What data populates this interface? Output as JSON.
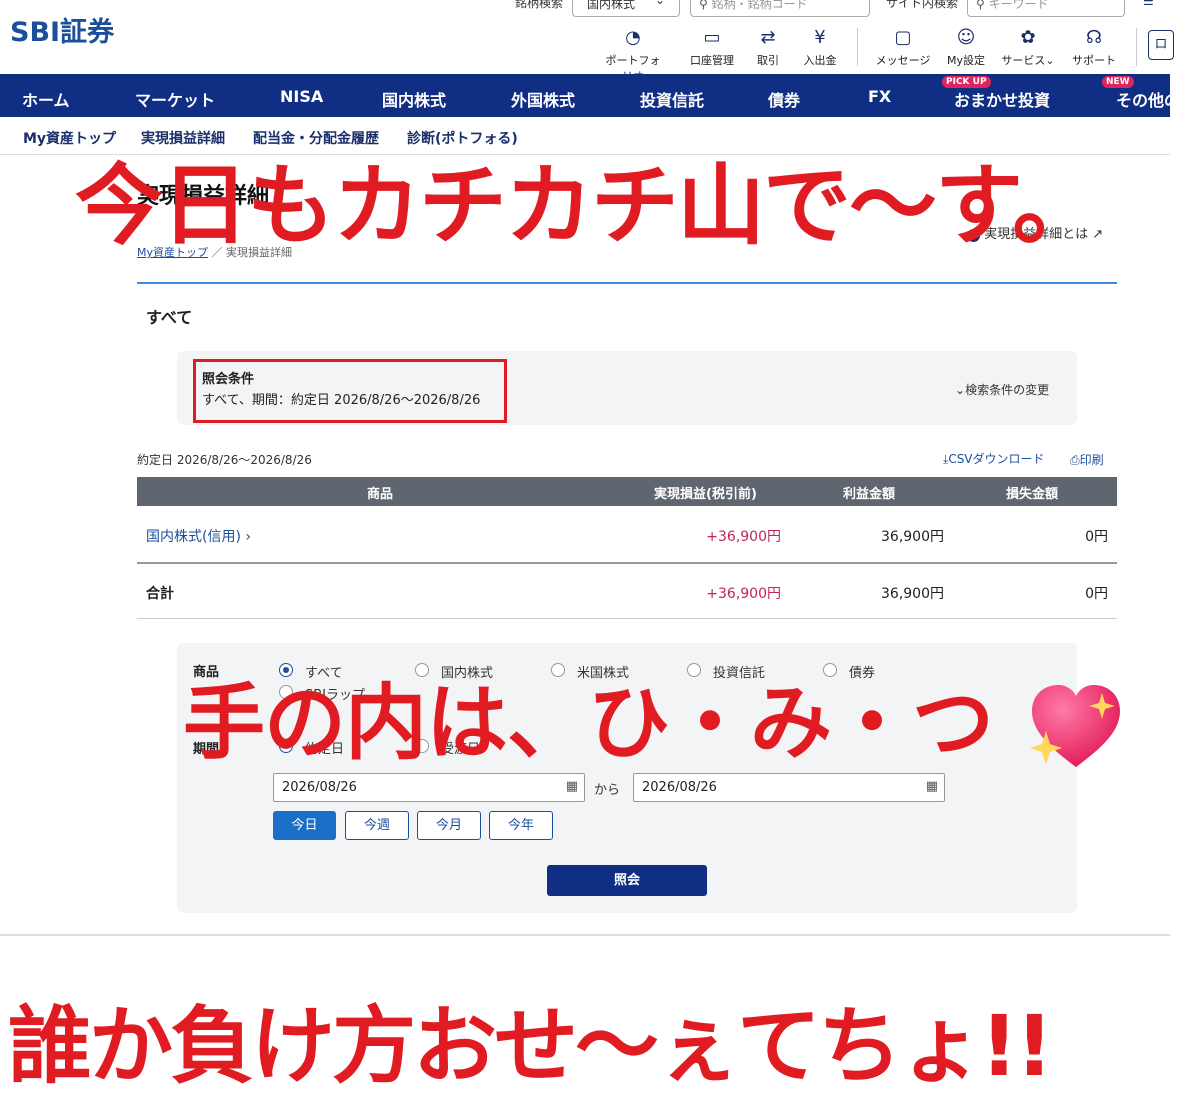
{
  "header": {
    "logo": "SBI証券",
    "stock_search_label": "銘柄検索",
    "stock_search_select": "国内株式",
    "stock_search_placeholder": "銘柄・銘柄コード",
    "site_search_label": "サイト内検索",
    "site_search_placeholder": "キーワード",
    "icons": [
      {
        "label": "ポートフォリオ",
        "icon": "pie-chart-icon"
      },
      {
        "label": "口座管理",
        "icon": "card-icon"
      },
      {
        "label": "取引",
        "icon": "exchange-icon"
      },
      {
        "label": "入出金",
        "icon": "yen-icon"
      },
      {
        "label": "メッセージ",
        "icon": "message-icon"
      },
      {
        "label": "My設定",
        "icon": "user-icon"
      },
      {
        "label": "サービス",
        "icon": "service-icon"
      },
      {
        "label": "サポート",
        "icon": "headset-icon"
      }
    ]
  },
  "nav": {
    "items": [
      "ホーム",
      "マーケット",
      "NISA",
      "国内株式",
      "外国株式",
      "投資信託",
      "債券",
      "FX",
      "おまかせ投資",
      "その他の"
    ],
    "badge_pickup": "PICK UP",
    "badge_new": "NEW"
  },
  "subnav": [
    "My資産トップ",
    "実現損益詳細",
    "配当金・分配金履歴",
    "診断(ポトフォる)"
  ],
  "page": {
    "title": "実現損益詳細",
    "help_link": "実現損益詳細とは",
    "breadcrumb_home": "My資産トップ",
    "breadcrumb_sep": "／",
    "breadcrumb_current": "実現損益詳細",
    "section_label": "すべて",
    "cond_title": "照会条件",
    "cond_text": "すべて、期間：約定日 2026/8/26〜2026/8/26",
    "cond_change": "検索条件の変更",
    "period_label": "約定日 2026/8/26〜2026/8/26",
    "csv": "CSVダウンロード",
    "print": "印刷"
  },
  "table": {
    "headers": [
      "商品",
      "実現損益(税引前)",
      "利益金額",
      "損失金額"
    ],
    "rows": [
      {
        "product": "国内株式(信用)",
        "pnl": "+36,900円",
        "profit": "36,900円",
        "loss": "0円"
      }
    ],
    "total": {
      "product": "合計",
      "pnl": "+36,900円",
      "profit": "36,900円",
      "loss": "0円"
    }
  },
  "form": {
    "product_label": "商品",
    "product_options": [
      "すべて",
      "国内株式",
      "米国株式",
      "投資信託",
      "債券",
      "SBIラップ"
    ],
    "period_label": "期間",
    "period_options": [
      "約定日",
      "受渡日"
    ],
    "date_from": "2026/08/26",
    "date_sep": "から",
    "date_to": "2026/08/26",
    "quick": [
      "今日",
      "今週",
      "今月",
      "今年"
    ],
    "submit": "照会"
  },
  "overlays": {
    "top": "今日もカチカチ山で〜す。",
    "middle": "手の内は、ひ・み・つ",
    "bottom": "誰か負け方おせ〜ぇてちょ!!"
  },
  "colors": {
    "brand": "#0f2e84",
    "overlay_red": "#e11b22",
    "profit_pink": "#c0245e"
  }
}
